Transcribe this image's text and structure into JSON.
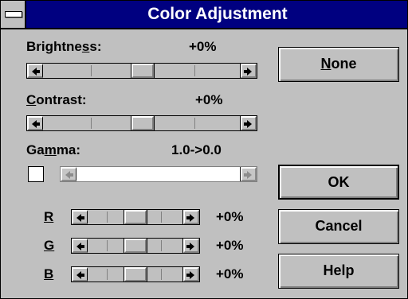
{
  "window": {
    "title": "Color Adjustment"
  },
  "brightness": {
    "label_pre": "Brightne",
    "label_ul": "s",
    "label_post": "s:",
    "value": "+0%",
    "thumb_fraction": 0.5
  },
  "contrast": {
    "label_ul": "C",
    "label_post": "ontrast:",
    "value": "+0%",
    "thumb_fraction": 0.5
  },
  "gamma": {
    "label_pre": "Ga",
    "label_ul": "m",
    "label_post": "ma:",
    "value": "1.0->0.0",
    "checked": false,
    "enabled": false
  },
  "rgb": [
    {
      "label": "R",
      "value": "+0%",
      "thumb_fraction": 0.5
    },
    {
      "label": "G",
      "value": "+0%",
      "thumb_fraction": 0.5
    },
    {
      "label": "B",
      "value": "+0%",
      "thumb_fraction": 0.5
    }
  ],
  "buttons": {
    "none": {
      "label_ul": "N",
      "label_post": "one"
    },
    "ok": "OK",
    "cancel": "Cancel",
    "help": "Help"
  },
  "icons": {
    "system_menu": "system-menu-icon",
    "left": "left-arrow-icon",
    "right": "right-arrow-icon"
  }
}
